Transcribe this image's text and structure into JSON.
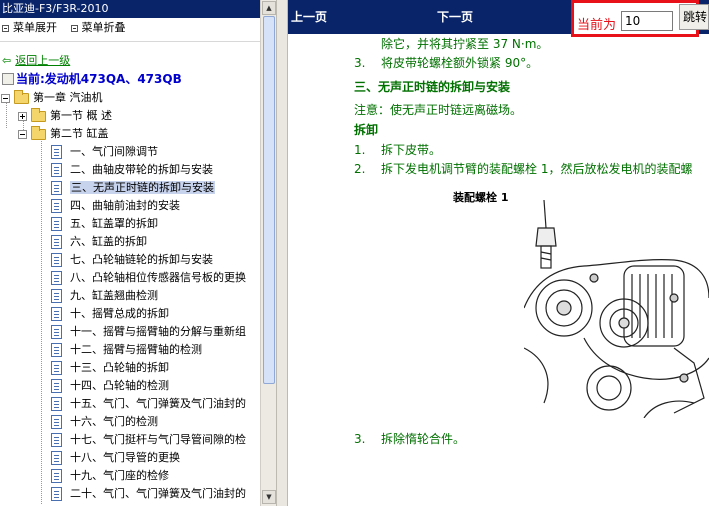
{
  "window": {
    "title": "比亚迪-F3/F3R-2010"
  },
  "tree_controls": {
    "expand_label": "菜单展开",
    "collapse_label": "菜单折叠"
  },
  "back_link": {
    "label": "返回上一级"
  },
  "current": {
    "label": "当前:发动机473QA、473QB"
  },
  "tree": {
    "chapter": "第一章  汽油机",
    "section1": "第一节  概  述",
    "section2": "第二节  缸盖",
    "items": [
      "一、气门间隙调节",
      "二、曲轴皮带轮的拆卸与安装",
      "三、无声正时链的拆卸与安装",
      "四、曲轴前油封的安装",
      "五、缸盖罩的拆卸",
      "六、缸盖的拆卸",
      "七、凸轮轴链轮的拆卸与安装",
      "八、凸轮轴相位传感器信号板的更换",
      "九、缸盖翘曲检测",
      "十、摇臂总成的拆卸",
      "十一、摇臂与摇臂轴的分解与重新组",
      "十二、摇臂与摇臂轴的检测",
      "十三、凸轮轴的拆卸",
      "十四、凸轮轴的检测",
      "十五、气门、气门弹簧及气门油封的",
      "十六、气门的检测",
      "十七、气门挺杆与气门导管间隙的检",
      "十八、气门导管的更换",
      "十九、气门座的检修",
      "二十、气门、气门弹簧及气门油封的"
    ],
    "selected_index": 2
  },
  "nav": {
    "prev_label": "上一页",
    "next_label": "下一页",
    "current_page_label": "当前为",
    "current_page_value": "10",
    "jump_label": "跳转"
  },
  "content": {
    "line1": "除它，并将其拧紧至 37 N·m。",
    "step3_num": "3.",
    "step3_text": "将皮带轮螺栓额外锁紧 90°。",
    "section_heading": "三、无声正时链的拆卸与安装",
    "note": "注意：使无声正时链远离磁场。",
    "subheading": "拆卸",
    "s1_num": "1.",
    "s1_text": "拆下皮带。",
    "s2_num": "2.",
    "s2_text": "拆下发电机调节臂的装配螺栓 1，然后放松发电机的装配螺",
    "s3_num": "3.",
    "s3_text": "拆除惰轮合件。",
    "diagram_label": "装配螺栓 1"
  },
  "colors": {
    "nav_bg": "#0a246a",
    "content_text": "#007000",
    "highlight_border": "#e8111a",
    "current_link": "#0000cc"
  }
}
